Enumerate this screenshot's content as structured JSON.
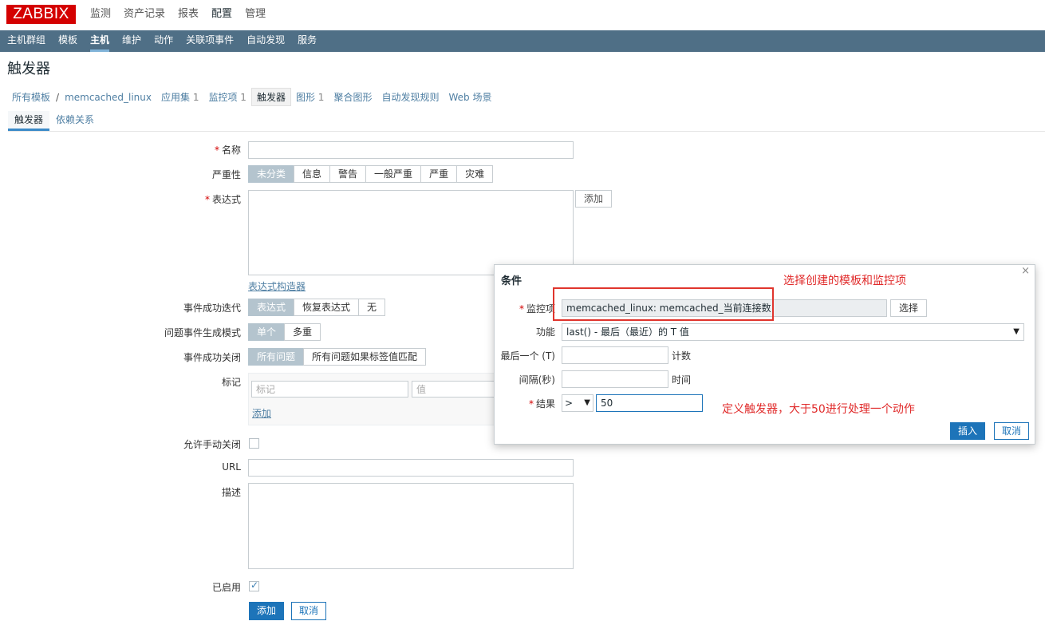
{
  "logo": "ZABBIX",
  "main_menu": [
    "监测",
    "资产记录",
    "报表",
    "配置",
    "管理"
  ],
  "sub_menu": [
    "主机群组",
    "模板",
    "主机",
    "维护",
    "动作",
    "关联项事件",
    "自动发现",
    "服务"
  ],
  "page_title": "触发器",
  "breadcrumb": {
    "all_templates": "所有模板",
    "separator": "/",
    "template": "memcached_linux",
    "apps": "应用集",
    "apps_count": "1",
    "items": "监控项",
    "items_count": "1",
    "triggers": "触发器",
    "graphs": "图形",
    "graphs_count": "1",
    "screens": "聚合图形",
    "discovery": "自动发现规则",
    "web": "Web 场景"
  },
  "tabs": [
    "触发器",
    "依赖关系"
  ],
  "form": {
    "name_label": "名称",
    "severity_label": "严重性",
    "severity_options": [
      "未分类",
      "信息",
      "警告",
      "一般严重",
      "严重",
      "灾难"
    ],
    "expression_label": "表达式",
    "add_button": "添加",
    "expression_constructor": "表达式构造器",
    "ok_event_label": "事件成功迭代",
    "ok_event_options": [
      "表达式",
      "恢复表达式",
      "无"
    ],
    "problem_mode_label": "问题事件生成模式",
    "problem_mode_options": [
      "单个",
      "多重"
    ],
    "ok_close_label": "事件成功关闭",
    "ok_close_options": [
      "所有问题",
      "所有问题如果标签值匹配"
    ],
    "tags_label": "标记",
    "tag_placeholder": "标记",
    "value_placeholder": "值",
    "tag_add_link": "添加",
    "manual_close_label": "允许手动关闭",
    "url_label": "URL",
    "description_label": "描述",
    "enabled_label": "已启用",
    "submit_button": "添加",
    "cancel_button": "取消"
  },
  "dialog": {
    "title": "条件",
    "close": "×",
    "item_label": "监控项",
    "item_value": "memcached_linux: memcached_当前连接数",
    "select_button": "选择",
    "function_label": "功能",
    "function_value": "last() - 最后（最近）的 T 值",
    "last_label": "最后一个 (T)",
    "last_unit": "计数",
    "interval_label": "间隔(秒)",
    "interval_unit": "时间",
    "result_label": "结果",
    "operator": ">",
    "result_value": "50",
    "insert_button": "插入",
    "cancel_button": "取消"
  },
  "annotations": {
    "select_note": "选择创建的模板和监控项",
    "trigger_note": "定义触发器，大于50进行处理一个动作"
  }
}
